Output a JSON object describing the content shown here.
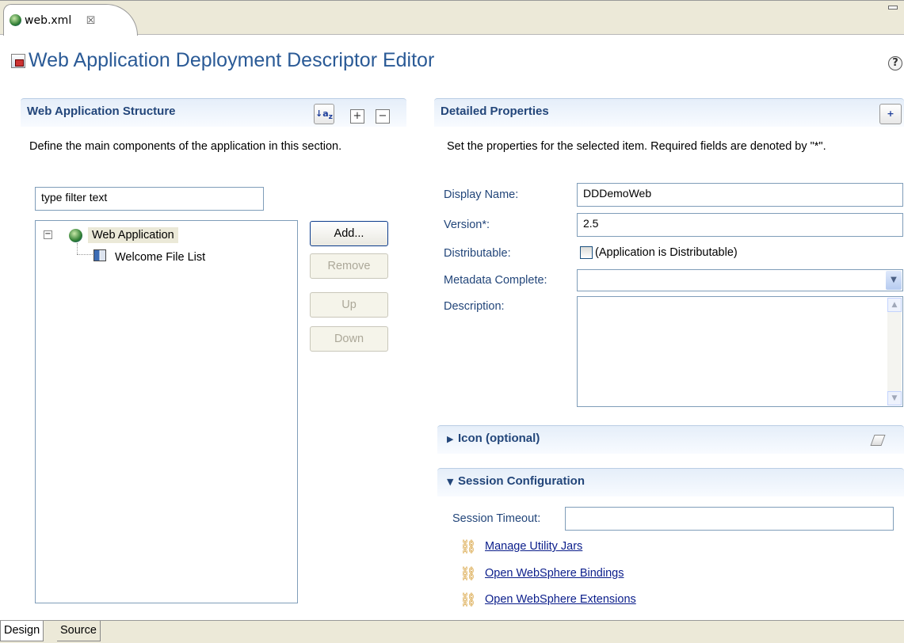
{
  "editor_tab": {
    "label": "web.xml",
    "close_glyph": "☒"
  },
  "page": {
    "title": "Web Application Deployment Descriptor Editor",
    "help_glyph": "?"
  },
  "structure": {
    "title": "Web Application Structure",
    "description": "Define the main components of the application in this section.",
    "filter_value": "type filter text",
    "tree": [
      {
        "label": "Web Application",
        "icon": "globe-icon",
        "expanded": true,
        "selected": true
      },
      {
        "label": "Welcome File List",
        "icon": "book-icon"
      }
    ],
    "buttons": {
      "add": "Add...",
      "remove": "Remove",
      "up": "Up",
      "down": "Down"
    }
  },
  "details": {
    "title": "Detailed Properties",
    "description": "Set the properties for the selected item. Required fields are denoted by \"*\".",
    "fields": {
      "display_name_label": "Display Name:",
      "display_name_value": "DDDemoWeb",
      "version_label": "Version*:",
      "version_value": "2.5",
      "distributable_label": "Distributable:",
      "distributable_checkbox_label": "(Application is Distributable)",
      "distributable_checked": false,
      "metadata_complete_label": "Metadata Complete:",
      "metadata_complete_value": "",
      "description_label": "Description:",
      "description_value": ""
    }
  },
  "icon_section": {
    "title": "Icon (optional)",
    "expanded": false
  },
  "session_section": {
    "title": "Session Configuration",
    "expanded": true,
    "timeout_label": "Session Timeout:",
    "timeout_value": ""
  },
  "links": [
    "Manage Utility Jars",
    "Open WebSphere Bindings",
    "Open WebSphere Extensions"
  ],
  "bottom_tabs": {
    "design": "Design",
    "source": "Source",
    "active": "Design"
  },
  "colors": {
    "section_title": "#23467a",
    "page_title": "#2a5a96",
    "link": "#0b1e8b",
    "chrome": "#ece9d8"
  }
}
